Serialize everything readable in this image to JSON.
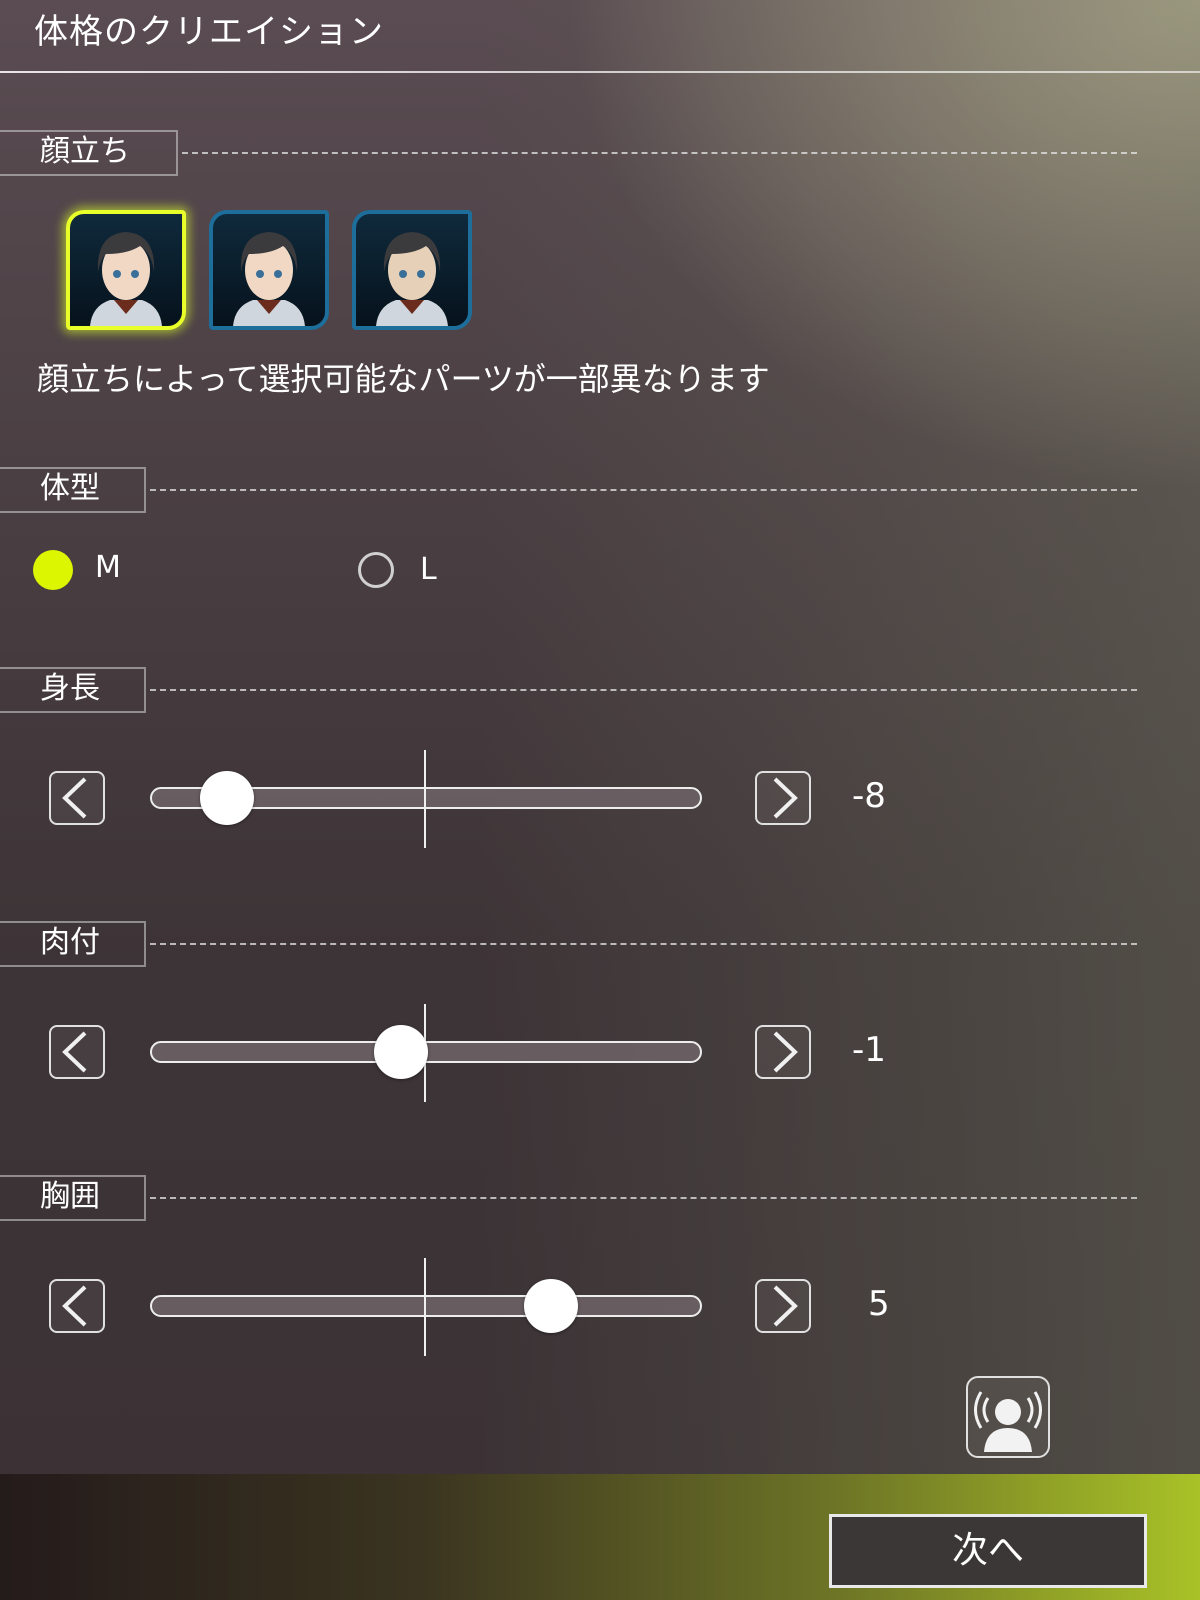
{
  "title": "体格のクリエイション",
  "sections": {
    "face": {
      "label": "顔立ち",
      "note": "顔立ちによって選択可能なパーツが一部異なります",
      "options": [
        "face-1",
        "face-2",
        "face-3"
      ],
      "selected_index": 0
    },
    "body_type": {
      "label": "体型",
      "options": [
        "M",
        "L"
      ],
      "selected": "M"
    },
    "height": {
      "label": "身長",
      "value": "-8",
      "value_fraction": 0.1
    },
    "flesh": {
      "label": "肉付",
      "value": "-1",
      "value_fraction": 0.45
    },
    "chest": {
      "label": "胸囲",
      "value": "5",
      "value_fraction": 0.75
    }
  },
  "icons": {
    "decrement": "chevron-left-icon",
    "increment": "chevron-right-icon",
    "avatar": "avatar-sound-icon"
  },
  "colors": {
    "accent": "#dbf600",
    "face_border": "#1e6e9c"
  },
  "footer": {
    "next_label": "次へ"
  }
}
